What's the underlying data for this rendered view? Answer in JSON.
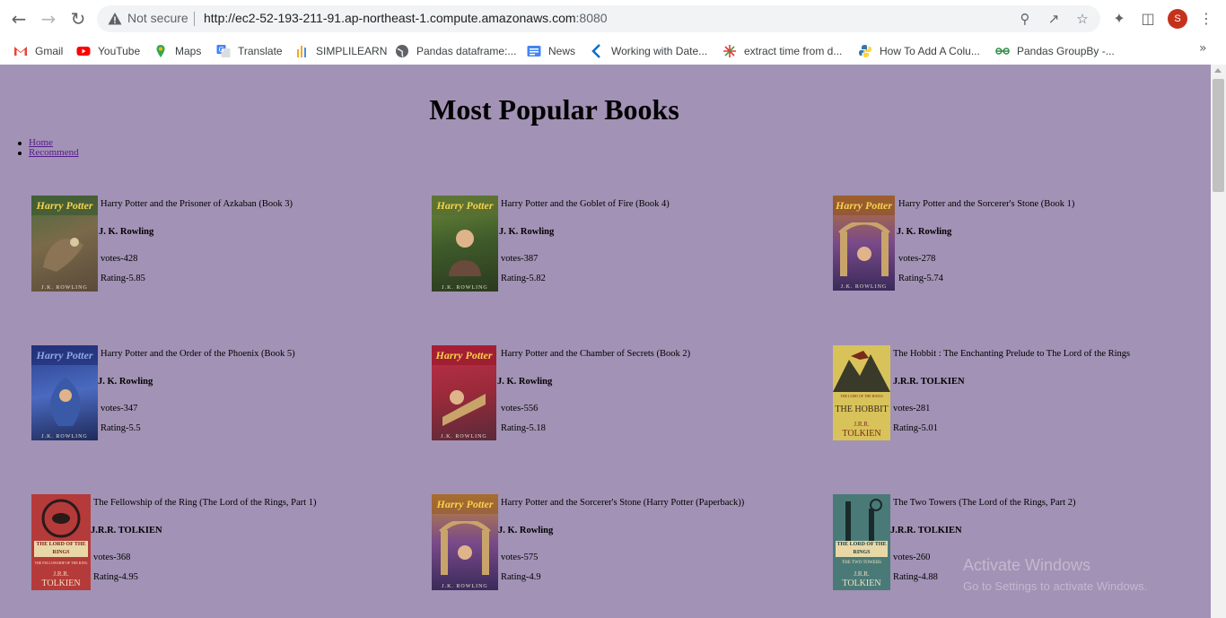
{
  "browser": {
    "not_secure": "Not secure",
    "url_main": "http://ec2-52-193-211-91.ap-northeast-1.compute.amazonaws.com",
    "url_port": ":8080",
    "profile_initial": "S",
    "bookmarks": [
      {
        "label": "Gmail",
        "icon": "gmail-icon"
      },
      {
        "label": "YouTube",
        "icon": "youtube-icon"
      },
      {
        "label": "Maps",
        "icon": "maps-icon"
      },
      {
        "label": "Translate",
        "icon": "translate-icon"
      },
      {
        "label": "SIMPLILEARN",
        "icon": "simplilearn-icon"
      },
      {
        "label": "Pandas dataframe:...",
        "icon": "globe-icon"
      },
      {
        "label": "News",
        "icon": "news-icon"
      },
      {
        "label": "Working with Date...",
        "icon": "bookmark-k-icon"
      },
      {
        "label": "extract time from d...",
        "icon": "bookmark-star-icon"
      },
      {
        "label": "How To Add A Colu...",
        "icon": "python-icon"
      },
      {
        "label": "Pandas GroupBy -...",
        "icon": "geeks-icon"
      }
    ]
  },
  "page": {
    "title": "Most Popular Books",
    "nav": [
      "Home",
      "Recommend"
    ],
    "books": [
      {
        "title": "Harry Potter and the Prisoner of Azkaban (Book 3)",
        "author": "J. K. Rowling",
        "votes": "votes-428",
        "rating": "Rating-5.85"
      },
      {
        "title": "Harry Potter and the Goblet of Fire (Book 4)",
        "author": "J. K. Rowling",
        "votes": "votes-387",
        "rating": "Rating-5.82"
      },
      {
        "title": "Harry Potter and the Sorcerer's Stone (Book 1)",
        "author": "J. K. Rowling",
        "votes": "votes-278",
        "rating": "Rating-5.74"
      },
      {
        "title": "Harry Potter and the Order of the Phoenix (Book 5)",
        "author": "J. K. Rowling",
        "votes": "votes-347",
        "rating": "Rating-5.5"
      },
      {
        "title": "Harry Potter and the Chamber of Secrets (Book 2)",
        "author": "J. K. Rowling",
        "votes": "votes-556",
        "rating": "Rating-5.18"
      },
      {
        "title": "The Hobbit : The Enchanting Prelude to The Lord of the Rings",
        "author": "J.R.R. TOLKIEN",
        "votes": "votes-281",
        "rating": "Rating-5.01"
      },
      {
        "title": "The Fellowship of the Ring (The Lord of the Rings, Part 1)",
        "author": "J.R.R. TOLKIEN",
        "votes": "votes-368",
        "rating": "Rating-4.95"
      },
      {
        "title": "Harry Potter and the Sorcerer's Stone (Harry Potter (Paperback))",
        "author": "J. K. Rowling",
        "votes": "votes-575",
        "rating": "Rating-4.9"
      },
      {
        "title": "The Two Towers (The Lord of the Rings, Part 2)",
        "author": "J.R.R. TOLKIEN",
        "votes": "votes-260",
        "rating": "Rating-4.88"
      }
    ],
    "covers": {
      "harry_potter": "Harry Potter",
      "rowling": "J.K. ROWLING",
      "lotr": "THE LORD OF THE RINGS",
      "fellowship": "THE FELLOWSHIP OF THE RING",
      "two_towers": "THE TWO TOWERS",
      "hobbit": "THE HOBBIT",
      "jrr": "J.R.R.",
      "tolkien": "TOLKIEN"
    }
  },
  "watermark": {
    "line1": "Activate Windows",
    "line2": "Go to Settings to activate Windows."
  },
  "colors": {
    "page_background": "#a292b5",
    "visited_link": "#551a8b",
    "profile": "#c5321b"
  }
}
